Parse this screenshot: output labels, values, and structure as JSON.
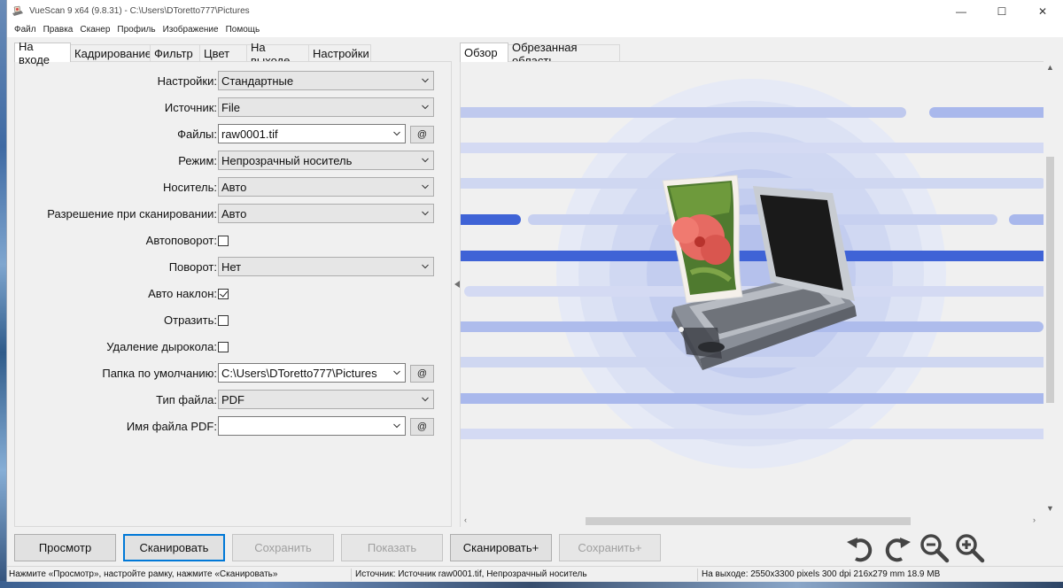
{
  "window": {
    "title": "VueScan 9 x64 (9.8.31) - C:\\Users\\DToretto777\\Pictures",
    "controls": {
      "minimize": "—",
      "maximize": "☐",
      "close": "✕"
    }
  },
  "menu": [
    "Файл",
    "Правка",
    "Сканер",
    "Профиль",
    "Изображение",
    "Помощь"
  ],
  "left_tabs": [
    "На входе",
    "Кадрирование",
    "Фильтр",
    "Цвет",
    "На выходе",
    "Настройки"
  ],
  "right_tabs": [
    "Обзор",
    "Обрезанная область"
  ],
  "settings": {
    "preset": {
      "label": "Настройки:",
      "value": "Стандартные"
    },
    "source": {
      "label": "Источник:",
      "value": "File"
    },
    "files": {
      "label": "Файлы:",
      "value": "raw0001.tif",
      "button": "@"
    },
    "mode": {
      "label": "Режим:",
      "value": "Непрозрачный носитель"
    },
    "media": {
      "label": "Носитель:",
      "value": "Авто"
    },
    "resolution": {
      "label": "Разрешение при сканировании:",
      "value": "Авто"
    },
    "autorotate": {
      "label": "Автоповорот:",
      "checked": false
    },
    "rotation": {
      "label": "Поворот:",
      "value": "Нет"
    },
    "autodeskew": {
      "label": "Авто наклон:",
      "checked": true
    },
    "mirror": {
      "label": "Отразить:",
      "checked": false
    },
    "hole_removal": {
      "label": "Удаление дырокола:",
      "checked": false
    },
    "default_folder": {
      "label": "Папка по умолчанию:",
      "value": "C:\\Users\\DToretto777\\Pictures",
      "button": "@"
    },
    "file_type": {
      "label": "Тип файла:",
      "value": "PDF"
    },
    "pdf_name": {
      "label": "Имя файла PDF:",
      "value": "",
      "button": "@"
    }
  },
  "buttons": {
    "preview": "Просмотр",
    "scan": "Сканировать",
    "save": "Сохранить",
    "show": "Показать",
    "scan_plus": "Сканировать+",
    "save_plus": "Сохранить+"
  },
  "status": {
    "hint": "Нажмите «Просмотр», настройте рамку, нажмите «Сканировать»",
    "source": "Источник: Источник raw0001.tif, Непрозрачный носитель",
    "output": "На выходе: 2550x3300 pixels 300 dpi 216x279 mm 18.9 MB"
  },
  "icons": {
    "rotate_left": "rotate-left-icon",
    "rotate_right": "rotate-right-icon",
    "zoom_out": "zoom-out-icon",
    "zoom_in": "zoom-in-icon"
  },
  "colors": {
    "accent": "#0078d7",
    "preview_stripe_light": "#c8d2f2",
    "preview_stripe_dark": "#3f63d6"
  }
}
